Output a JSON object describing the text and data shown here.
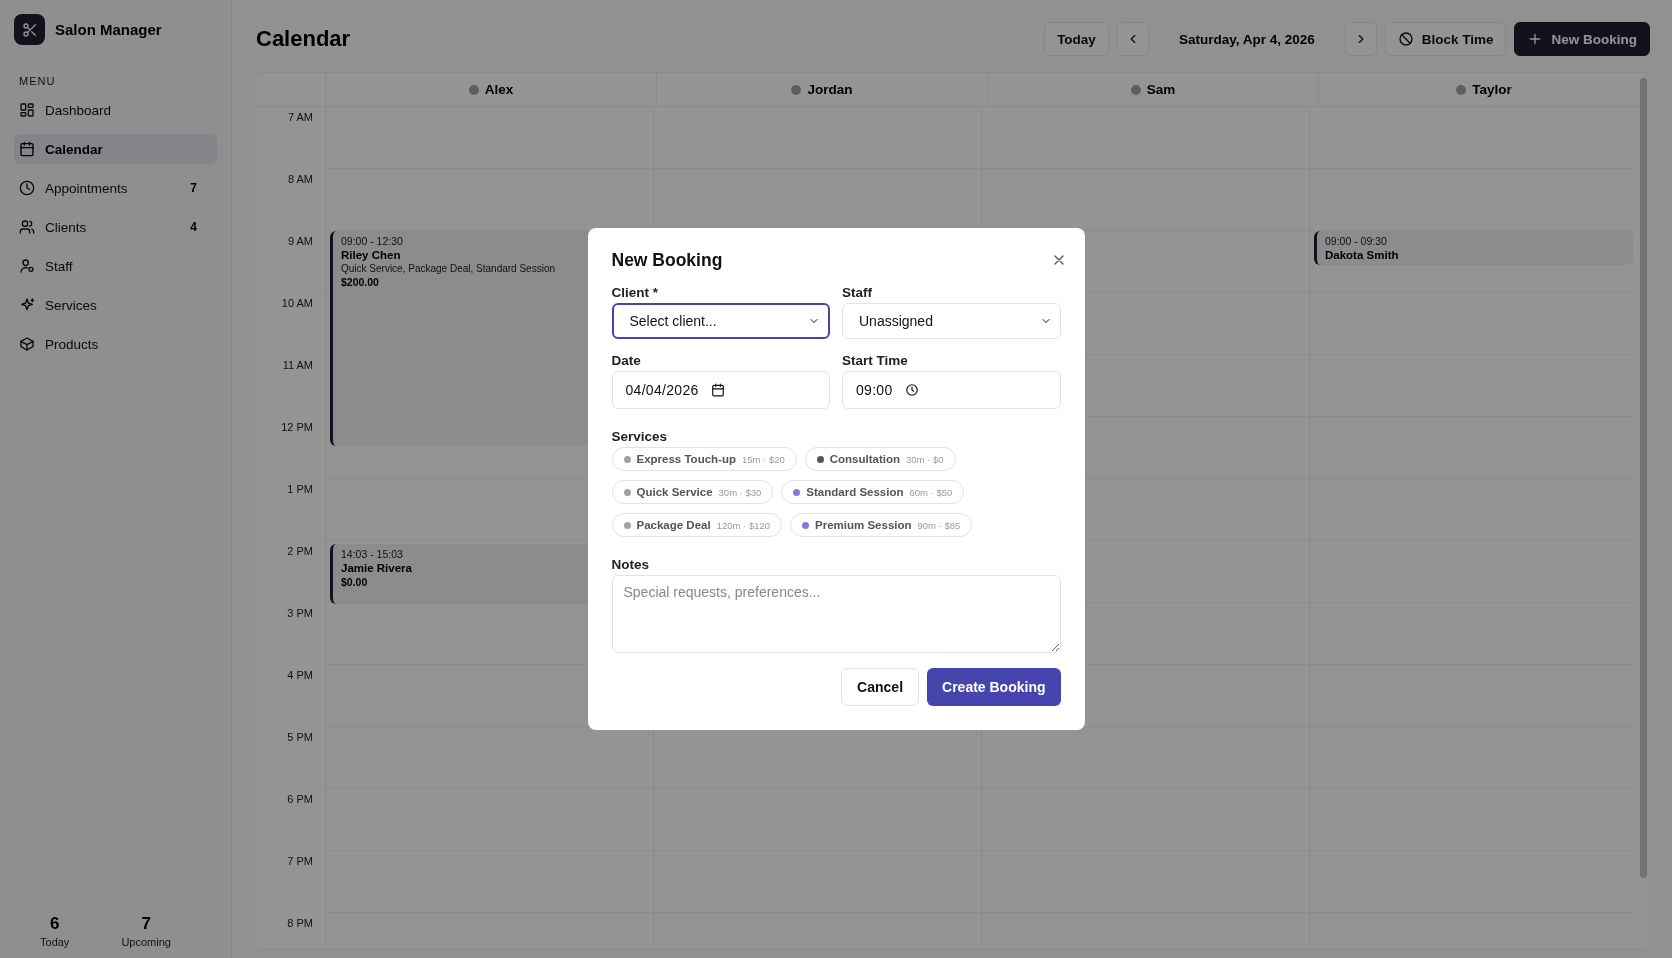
{
  "app": {
    "title": "Salon Manager"
  },
  "sidebar": {
    "section_label": "MENU",
    "items": [
      {
        "label": "Dashboard",
        "selected": false
      },
      {
        "label": "Calendar",
        "selected": true
      },
      {
        "label": "Appointments",
        "selected": false,
        "count": "7"
      },
      {
        "label": "Clients",
        "selected": false,
        "count": "4"
      },
      {
        "label": "Staff",
        "selected": false
      },
      {
        "label": "Services",
        "selected": false
      },
      {
        "label": "Products",
        "selected": false
      }
    ],
    "stats": [
      {
        "value": "6",
        "label": "Today"
      },
      {
        "value": "7",
        "label": "Upcoming"
      }
    ]
  },
  "header": {
    "title": "Calendar",
    "today_button": "Today",
    "date": "Saturday, Apr 4, 2026",
    "block_button": "Block Time",
    "new_button": "New Booking"
  },
  "calendar": {
    "hours": [
      "7 AM",
      "8 AM",
      "9 AM",
      "10 AM",
      "11 AM",
      "12 PM",
      "1 PM",
      "2 PM",
      "3 PM",
      "4 PM",
      "5 PM",
      "6 PM",
      "7 PM",
      "8 PM"
    ],
    "staff": [
      {
        "name": "Alex",
        "events": [
          {
            "time": "09:00 - 12:30",
            "client": "Riley Chen",
            "services": "Quick Service, Package Deal, Standard Session",
            "price": "$200.00"
          },
          {
            "time": "14:03 - 15:03",
            "client": "Jamie Rivera",
            "price": "$0.00"
          }
        ]
      },
      {
        "name": "Jordan"
      },
      {
        "name": "Sam"
      },
      {
        "name": "Taylor",
        "events": [
          {
            "time": "09:00 - 09:30",
            "client": "Dakota Smith"
          }
        ]
      }
    ]
  },
  "dialog": {
    "title": "New Booking",
    "client": {
      "label": "Client *",
      "value": "Select client...",
      "focused": true
    },
    "staff": {
      "label": "Staff",
      "value": "Unassigned",
      "focused": false
    },
    "date": {
      "label": "Date",
      "value": "04/04/2026"
    },
    "start_time": {
      "label": "Start Time",
      "value": "09:00"
    },
    "services_label": "Services",
    "services": [
      {
        "name": "Express Touch-up",
        "meta": "15m · $20",
        "color": "#9ca3af",
        "selected": false
      },
      {
        "name": "Consultation",
        "meta": "30m · $0",
        "color": "#4b5563",
        "selected": false
      },
      {
        "name": "Quick Service",
        "meta": "30m · $30",
        "color": "#9ca3af",
        "selected": false
      },
      {
        "name": "Standard Session",
        "meta": "60m · $50",
        "color": "#7c7ce0",
        "selected": false
      },
      {
        "name": "Package Deal",
        "meta": "120m · $120",
        "color": "#9ca3af",
        "selected": false
      },
      {
        "name": "Premium Session",
        "meta": "90m · $85",
        "color": "#7c7ce0",
        "selected": false
      }
    ],
    "notes": {
      "label": "Notes",
      "placeholder": "Special requests, preferences..."
    },
    "cancel_button": "Cancel",
    "create_button": "Create Booking"
  }
}
